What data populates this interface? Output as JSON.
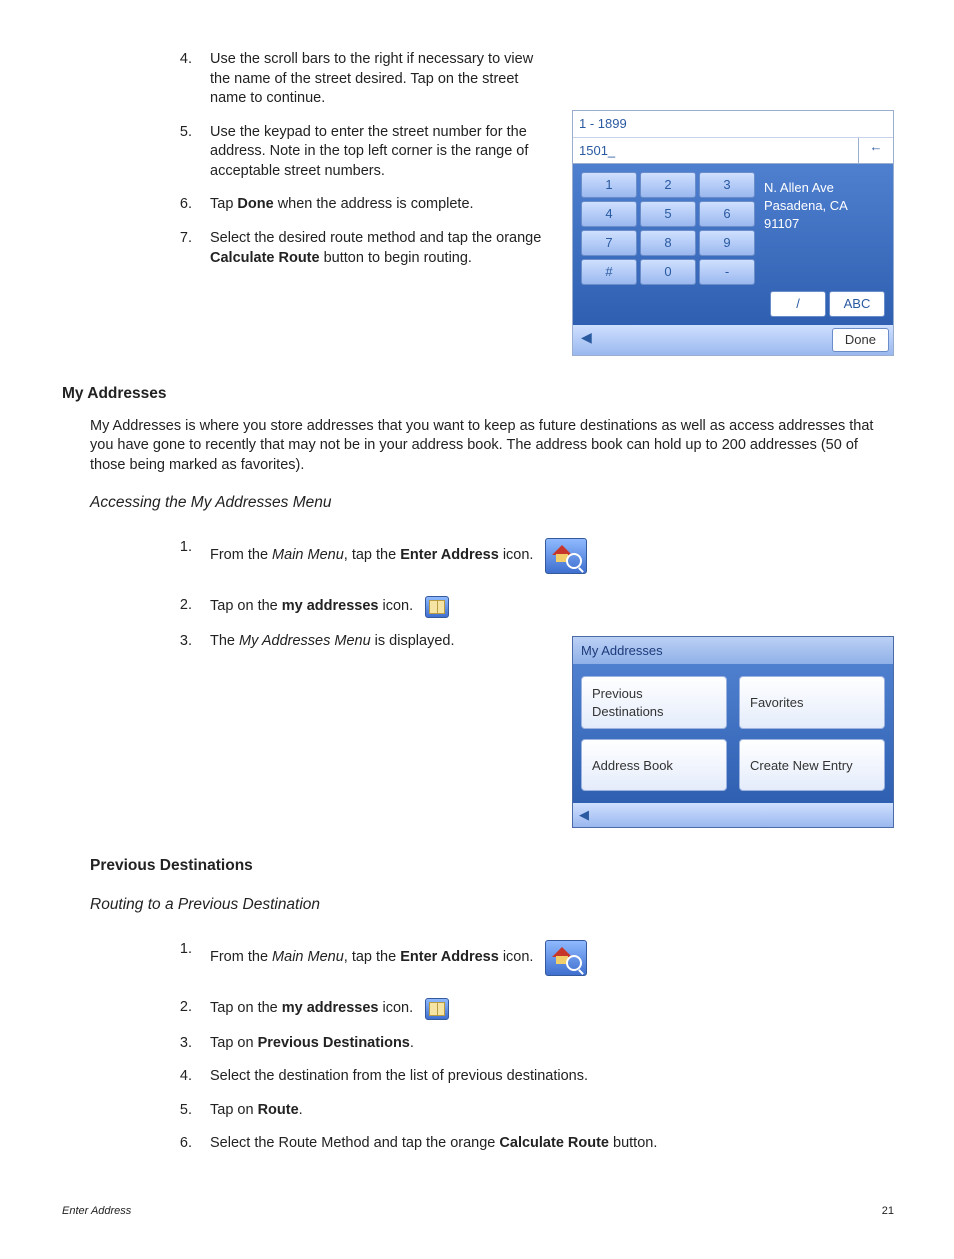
{
  "steps_top": [
    {
      "n": "4.",
      "t": "Use the scroll bars to the right if necessary to view the name of the street desired.  Tap on the street name to continue."
    },
    {
      "n": "5.",
      "t": "Use the keypad to enter the street number for the address.  Note in the top left corner is the range of acceptable street numbers."
    },
    {
      "n": "6.",
      "t_pre": "Tap ",
      "b": "Done",
      "t_post": " when the address is complete."
    },
    {
      "n": "7.",
      "t_pre": "Select the desired route method and tap the orange ",
      "b": "Calculate Route",
      "t_post": " button to begin routing."
    }
  ],
  "keypad": {
    "range": "1 - 1899",
    "value": "1501_",
    "back": "←",
    "keys": [
      [
        "1",
        "2",
        "3"
      ],
      [
        "4",
        "5",
        "6"
      ],
      [
        "7",
        "8",
        "9"
      ],
      [
        "#",
        "0",
        "-"
      ]
    ],
    "extra": [
      "/",
      "ABC"
    ],
    "addr1": "N. Allen Ave",
    "addr2": "Pasadena, CA 91107",
    "done": "Done",
    "tri": "◀"
  },
  "h_myaddr": "My Addresses",
  "p_myaddr": "My Addresses is where you store addresses that you want to keep as future destinations as well as access addresses that you have gone to recently that may not be in your address book.  The address book can hold up to 200 addresses (50 of those being marked as favorites).",
  "h_access": "Accessing the My Addresses Menu",
  "access_steps": [
    {
      "n": "1.",
      "pre": "From the ",
      "i": "Main Menu",
      "mid": ", tap the ",
      "b": "Enter Address",
      "post": " icon."
    },
    {
      "n": "2.",
      "pre": "Tap on the ",
      "b": "my addresses",
      "post": " icon."
    },
    {
      "n": "3.",
      "pre": "The ",
      "i": "My Addresses Menu",
      "post": " is displayed."
    }
  ],
  "ma_shot": {
    "title": "My Addresses",
    "b1": "Previous Destinations",
    "b2": "Favorites",
    "b3": "Address Book",
    "b4": "Create New Entry",
    "tri": "◀"
  },
  "h_prev": "Previous Destinations",
  "h_route": "Routing to a Previous Destination",
  "route_steps": [
    {
      "n": "1.",
      "pre": "From the ",
      "i": "Main Menu",
      "mid": ", tap the ",
      "b": "Enter Address",
      "post": " icon."
    },
    {
      "n": "2.",
      "pre": "Tap on the ",
      "b": "my addresses",
      "post": " icon."
    },
    {
      "n": "3.",
      "pre": "Tap on ",
      "b": "Previous Destinations",
      "post": "."
    },
    {
      "n": "4.",
      "pre": "Select the destination from the list of previous destinations."
    },
    {
      "n": "5.",
      "pre": "Tap on ",
      "b": "Route",
      "post": "."
    },
    {
      "n": "6.",
      "pre": "Select the Route Method and tap the orange ",
      "b": "Calculate Route",
      "post": " button."
    }
  ],
  "footer_left": "Enter Address",
  "footer_right": "21"
}
